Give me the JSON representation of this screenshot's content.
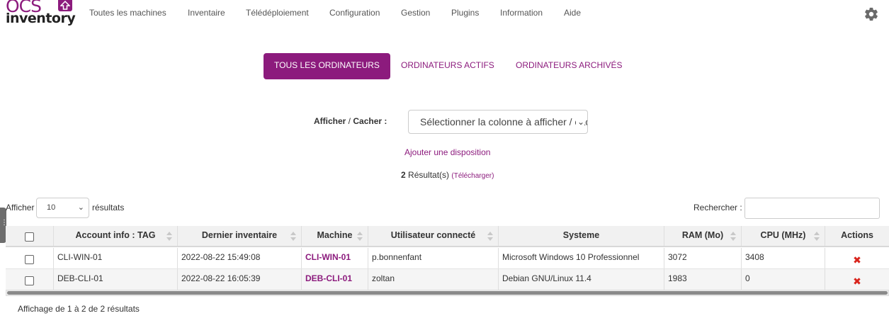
{
  "brand": {
    "logo_top": "OCS",
    "logo_bottom": "inventory",
    "accent": "#8c1b7d"
  },
  "nav": {
    "items": [
      "Toutes les machines",
      "Inventaire",
      "Télédéploiement",
      "Configuration",
      "Gestion",
      "Plugins",
      "Information",
      "Aide"
    ],
    "settings_icon": "gear-icon"
  },
  "tabs": [
    {
      "label": "TOUS LES ORDINATEURS",
      "active": true
    },
    {
      "label": "ORDINATEURS ACTIFS",
      "active": false
    },
    {
      "label": "ORDINATEURS ARCHIVÉS",
      "active": false
    }
  ],
  "columns_chooser": {
    "label_bold": "Afficher",
    "label_sep": " / ",
    "label_bold2": "Cacher :",
    "select_value": "Sélectionner la colonne à afficher / cacher",
    "add_layout": "Ajouter une disposition"
  },
  "results": {
    "count": "2",
    "label": "Résultat(s)",
    "download": "(Télécharger)"
  },
  "length": {
    "prefix": "Afficher",
    "value": "10",
    "suffix": "résultats"
  },
  "search": {
    "label": "Rechercher :",
    "value": ""
  },
  "table": {
    "headers": [
      "Account info : TAG",
      "Dernier inventaire",
      "Machine",
      "Utilisateur connecté",
      "Systeme",
      "RAM (Mo)",
      "CPU (MHz)",
      "Actions"
    ],
    "rows": [
      {
        "tag": "CLI-WIN-01",
        "last_inventory": "2022-08-22 15:49:08",
        "machine": "CLI-WIN-01",
        "user": "p.bonnenfant",
        "system": "Microsoft Windows 10 Professionnel",
        "ram": "3072",
        "cpu": "3408"
      },
      {
        "tag": "DEB-CLI-01",
        "last_inventory": "2022-08-22 16:05:39",
        "machine": "DEB-CLI-01",
        "user": "zoltan",
        "system": "Debian GNU/Linux 11.4",
        "ram": "1983",
        "cpu": "0"
      }
    ],
    "delete_icon": "delete-icon"
  },
  "footer": {
    "info": "Affichage de 1 à 2 de 2 résultats"
  }
}
